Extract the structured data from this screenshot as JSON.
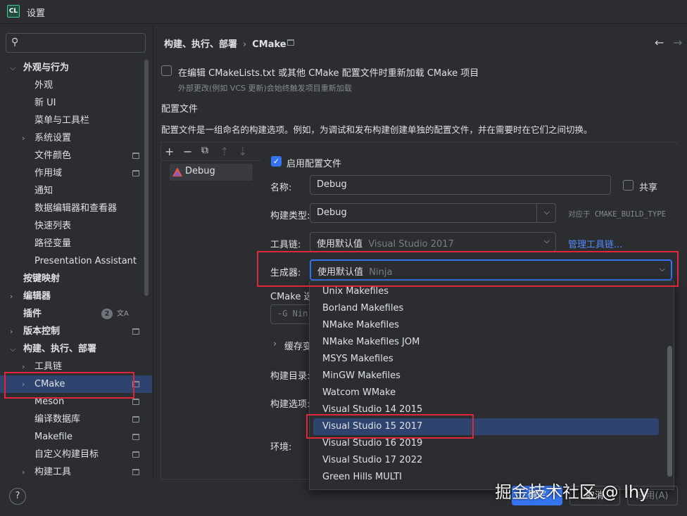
{
  "window": {
    "app_icon": "CL",
    "title": "设置"
  },
  "sidebar": {
    "search_placeholder": "",
    "items": [
      {
        "label": "外观与行为",
        "arrow": "⌵",
        "bold": true
      },
      {
        "label": "外观"
      },
      {
        "label": "新 UI"
      },
      {
        "label": "菜单与工具栏"
      },
      {
        "label": "系统设置",
        "arrow": "›"
      },
      {
        "label": "文件颜色",
        "pin": true
      },
      {
        "label": "作用域",
        "pin": true
      },
      {
        "label": "通知"
      },
      {
        "label": "数据编辑器和查看器"
      },
      {
        "label": "快速列表"
      },
      {
        "label": "路径变量"
      },
      {
        "label": "Presentation Assistant"
      },
      {
        "label": "按键映射",
        "bold": true
      },
      {
        "label": "编辑器",
        "arrow": "›",
        "bold": true
      },
      {
        "label": "插件",
        "bold": true,
        "badge": "2"
      },
      {
        "label": "版本控制",
        "arrow": "›",
        "bold": true,
        "pin": true
      },
      {
        "label": "构建、执行、部署",
        "arrow": "⌵",
        "bold": true
      },
      {
        "label": "工具链",
        "arrow": "›"
      },
      {
        "label": "CMake",
        "arrow": "›",
        "pin": true,
        "selected": true
      },
      {
        "label": "Meson",
        "pin": true
      },
      {
        "label": "编译数据库",
        "pin": true
      },
      {
        "label": "Makefile",
        "pin": true
      },
      {
        "label": "自定义构建目标",
        "pin": true
      },
      {
        "label": "构建工具",
        "arrow": "›",
        "pin": true
      }
    ]
  },
  "breadcrumb": {
    "parent": "构建、执行、部署",
    "separator": "›",
    "current": "CMake"
  },
  "reload": {
    "label": "在编辑 CMakeLists.txt 或其他 CMake 配置文件时重新加载 CMake 项目",
    "hint": "外部更改(例如 VCS 更新)会始终触发项目重新加载",
    "checked": false
  },
  "profiles": {
    "title": "配置文件",
    "description": "配置文件是一组命名的构建选项。例如，为调试和发布构建创建单独的配置文件，并在需要时在它们之间切换。",
    "toolbar": {
      "add": "+",
      "remove": "−",
      "copy": "⧉",
      "up": "⇡",
      "down": "⇣"
    },
    "list": [
      "Debug"
    ]
  },
  "detail": {
    "enable_label": "启用配置文件",
    "name_label": "名称:",
    "name_value": "Debug",
    "share_label": "共享",
    "build_type_label": "构建类型:",
    "build_type_value": "Debug",
    "build_type_hint": "对应于 CMAKE_BUILD_TYPE",
    "toolchain_label": "工具链:",
    "toolchain_value": "使用默认值",
    "toolchain_muted": "Visual Studio 2017",
    "manage_toolchains": "管理工具链...",
    "generator_label": "生成器:",
    "generator_value": "使用默认值",
    "generator_muted": "Ninja",
    "cmake_options_label": "CMake 选",
    "cmake_options_value": "-G Ninj",
    "cache_label": "缓存变",
    "build_dir_label": "构建目录:",
    "build_options_label": "构建选项:",
    "env_label": "环境:"
  },
  "generator_dropdown": {
    "options": [
      "Unix Makefiles",
      "Borland Makefiles",
      "NMake Makefiles",
      "NMake Makefiles JOM",
      "MSYS Makefiles",
      "MinGW Makefiles",
      "Watcom WMake",
      "Visual Studio 14 2015",
      "Visual Studio 15 2017",
      "Visual Studio 16 2019",
      "Visual Studio 17 2022",
      "Green Hills MULTI"
    ],
    "selected": "Visual Studio 15 2017"
  },
  "footer": {
    "help": "?",
    "ok": "确定",
    "cancel": "取消",
    "apply": "应用(A)"
  },
  "watermark": "掘金技术社区 @ lhy",
  "colors": {
    "accent": "#3574f0",
    "selection": "#2e436e",
    "highlight_box": "#e0263a",
    "link": "#548af7"
  }
}
